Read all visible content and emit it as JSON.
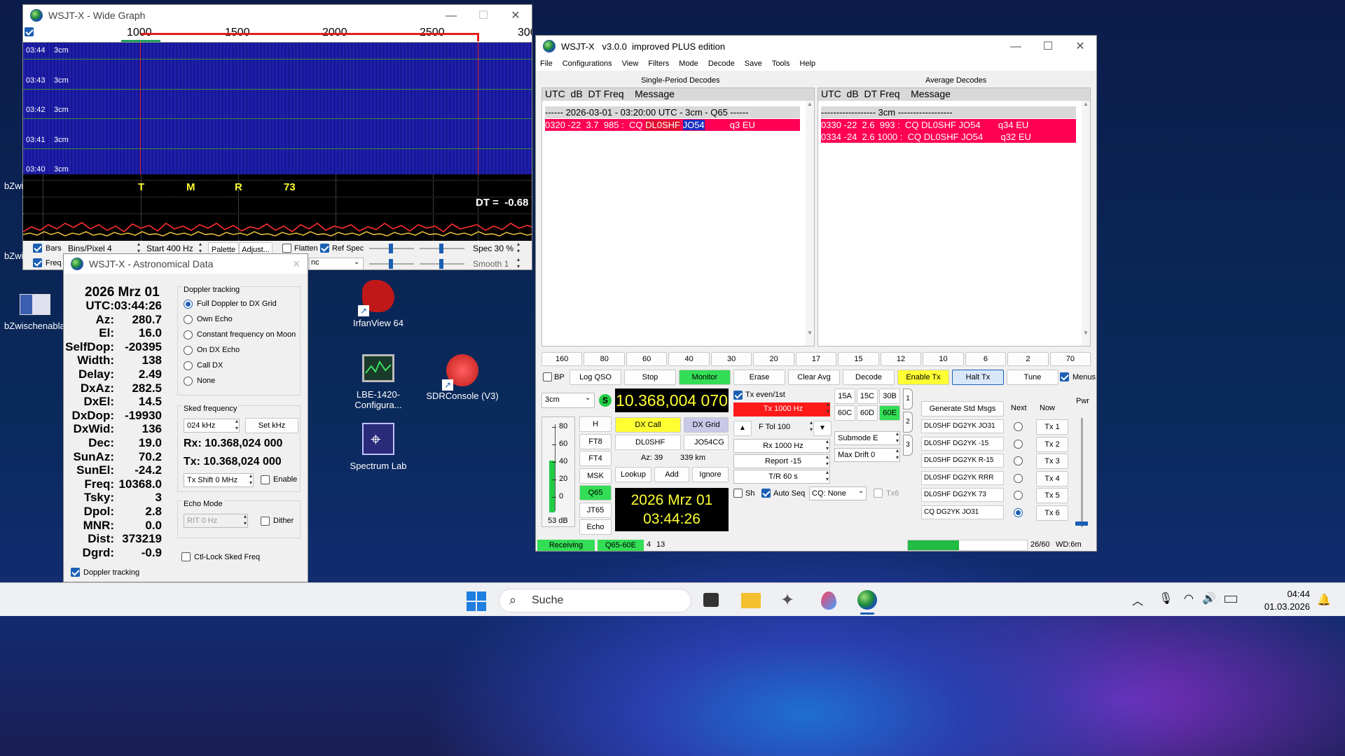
{
  "wide_graph": {
    "title": "WSJT-X - Wide Graph",
    "scale_labels": [
      "1000",
      "1500",
      "2000",
      "2500",
      "300"
    ],
    "rows": [
      {
        "time": "03:44",
        "band": "3cm"
      },
      {
        "time": "03:43",
        "band": "3cm"
      },
      {
        "time": "03:42",
        "band": "3cm"
      },
      {
        "time": "03:41",
        "band": "3cm"
      },
      {
        "time": "03:40",
        "band": "3cm"
      }
    ],
    "markers": [
      "T",
      "M",
      "R",
      "73"
    ],
    "dt_label": "DT =  -0.68",
    "controls": {
      "bars": "Bars",
      "bins": "Bins/Pixel  4",
      "start": "Start 400 Hz",
      "palette": "Palette",
      "adjust": "Adjust...",
      "flatten": "Flatten",
      "ref_spec": "Ref Spec",
      "spec": "Spec 30 %",
      "freq": "Freq",
      "smooth": "Smooth  1",
      "cumulative": "nc"
    }
  },
  "astro": {
    "title": "WSJT-X - Astronomical Data",
    "date": "2026 Mrz 01",
    "values": [
      {
        "k": "UTC:",
        "v": "03:44:26"
      },
      {
        "k": "Az:",
        "v": "280.7"
      },
      {
        "k": "El:",
        "v": "16.0"
      },
      {
        "k": "SelfDop:",
        "v": "-20395"
      },
      {
        "k": "Width:",
        "v": "138"
      },
      {
        "k": "Delay:",
        "v": "2.49"
      },
      {
        "k": "DxAz:",
        "v": "282.5"
      },
      {
        "k": "DxEl:",
        "v": "14.5"
      },
      {
        "k": "DxDop:",
        "v": "-19930"
      },
      {
        "k": "DxWid:",
        "v": "136"
      },
      {
        "k": "Dec:",
        "v": "19.0"
      },
      {
        "k": "SunAz:",
        "v": "70.2"
      },
      {
        "k": "SunEl:",
        "v": "-24.2"
      },
      {
        "k": "Freq:",
        "v": "10368.0"
      },
      {
        "k": "Tsky:",
        "v": "3"
      },
      {
        "k": "Dpol:",
        "v": "2.8"
      },
      {
        "k": "MNR:",
        "v": "0.0"
      },
      {
        "k": "Dist:",
        "v": "373219"
      },
      {
        "k": "Dgrd:",
        "v": "-0.9"
      }
    ],
    "doppler_group": "Doppler tracking",
    "doppler_options": [
      "Full Doppler to DX Grid",
      "Own Echo",
      "Constant frequency on Moon",
      "On DX Echo",
      "Call DX",
      "None"
    ],
    "sked_group": "Sked frequency",
    "sked_value": "024  kHz",
    "set_khz": "Set kHz",
    "rx": "Rx: 10.368,024 000",
    "tx": "Tx: 10.368,024 000",
    "tx_shift": "Tx Shift  0  MHz",
    "enable": "Enable",
    "echo_group": "Echo Mode",
    "rit": "RIT  0  Hz",
    "dither": "Dither",
    "ctl_lock": "Ctl-Lock Sked Freq",
    "doppler_tracking": "Doppler tracking"
  },
  "desktop": {
    "icons": [
      {
        "label": "IrfanView 64"
      },
      {
        "label": "LBE-1420-Configura..."
      },
      {
        "label": "SDRConsole (V3)"
      },
      {
        "label": "Spectrum Lab"
      },
      {
        "label": "bZwischenabla"
      }
    ],
    "edge_labels": [
      "bZwi",
      "bZwi"
    ]
  },
  "main": {
    "title": "WSJT-X   v3.0.0  improved PLUS edition",
    "menu": [
      "File",
      "Configurations",
      "View",
      "Filters",
      "Mode",
      "Decode",
      "Save",
      "Tools",
      "Help"
    ],
    "single_title": "Single-Period Decodes",
    "average_title": "Average Decodes",
    "col_header": "UTC  dB  DT Freq    Message",
    "single_lines": {
      "sep": "------ 2026-03-01 - 03:20:00 UTC - 3cm - Q65 ------",
      "d1_pre": "0320 -22  3.7  985 :  CQ ",
      "d1_call": "DL0SHF",
      "d1_mid": " ",
      "d1_grid": "JO54",
      "d1_post": "          q3 EU"
    },
    "average_lines": {
      "sep": "------------------ 3cm ------------------",
      "d1": "0330 -22  2.6  993 :  CQ DL0SHF JO54       q34 EU",
      "d2": "0334 -24  2.6 1000 :  CQ DL0SHF JO54       q32 EU"
    },
    "bands": [
      "160",
      "80",
      "60",
      "40",
      "30",
      "20",
      "17",
      "15",
      "12",
      "10",
      "6",
      "2",
      "70"
    ],
    "buttons": {
      "bp": "BP",
      "log_qso": "Log QSO",
      "stop": "Stop",
      "monitor": "Monitor",
      "erase": "Erase",
      "clear_avg": "Clear Avg",
      "decode": "Decode",
      "enable_tx": "Enable Tx",
      "halt_tx": "Halt Tx",
      "tune": "Tune",
      "menus": "Menus"
    },
    "band_select": "3cm",
    "freq_display": "10.368,004 070",
    "s_label": "S",
    "meter_ticks": [
      "80",
      "60",
      "40",
      "20",
      "0"
    ],
    "meter_db": "53 dB",
    "modes": [
      "H",
      "FT8",
      "FT4",
      "MSK",
      "Q65",
      "JT65",
      "Echo"
    ],
    "dx_call_btn": "DX Call",
    "dx_grid_btn": "DX Grid",
    "dx_call": "DL0SHF",
    "dx_grid": "JO54CG",
    "az": "Az: 39",
    "dist": "339 km",
    "lookup": "Lookup",
    "add": "Add",
    "ignore": "Ignore",
    "date": "2026 Mrz 01",
    "time": "03:44:26",
    "tx_even": "Tx even/1st",
    "tx_hz": "Tx  1000  Hz",
    "ftol": "F Tol  100",
    "rx_hz": "Rx  1000  Hz",
    "report": "Report -15",
    "tr": "T/R  60  s",
    "sh": "Sh",
    "auto_seq": "Auto Seq",
    "cq": "CQ: None",
    "tx6_chk": "Tx6",
    "submodes": [
      "15A",
      "15C",
      "30B",
      "60C",
      "60D",
      "60E"
    ],
    "submode": "Submode E",
    "max_drift": "Max Drift  0",
    "side_tabs": [
      "1",
      "2",
      "3"
    ],
    "gen_msgs": "Generate Std Msgs",
    "next": "Next",
    "now": "Now",
    "pwr": "Pwr",
    "messages": [
      {
        "text": "DL0SHF DG2YK JO31",
        "tx": "Tx 1"
      },
      {
        "text": "DL0SHF DG2YK -15",
        "tx": "Tx 2"
      },
      {
        "text": "DL0SHF DG2YK R-15",
        "tx": "Tx 3"
      },
      {
        "text": "DL0SHF DG2YK RRR",
        "tx": "Tx 4"
      },
      {
        "text": "DL0SHF DG2YK 73",
        "tx": "Tx 5"
      },
      {
        "text": "CQ DG2YK JO31",
        "tx": "Tx 6"
      }
    ],
    "status": {
      "receiving": "Receiving",
      "mode": "Q65-60E",
      "a": "4",
      "b": "13",
      "progress_label": "26/60",
      "progress": 0.43,
      "wd": "WD:6m"
    }
  },
  "taskbar": {
    "search": "Suche",
    "time": "04:44",
    "date": "01.03.2026"
  },
  "colors": {
    "accent": "#1a5fb4",
    "green": "#33dd55",
    "decode_red": "#ff0055",
    "yellow": "#ffff33",
    "waterfall": "#1a1aa0"
  }
}
